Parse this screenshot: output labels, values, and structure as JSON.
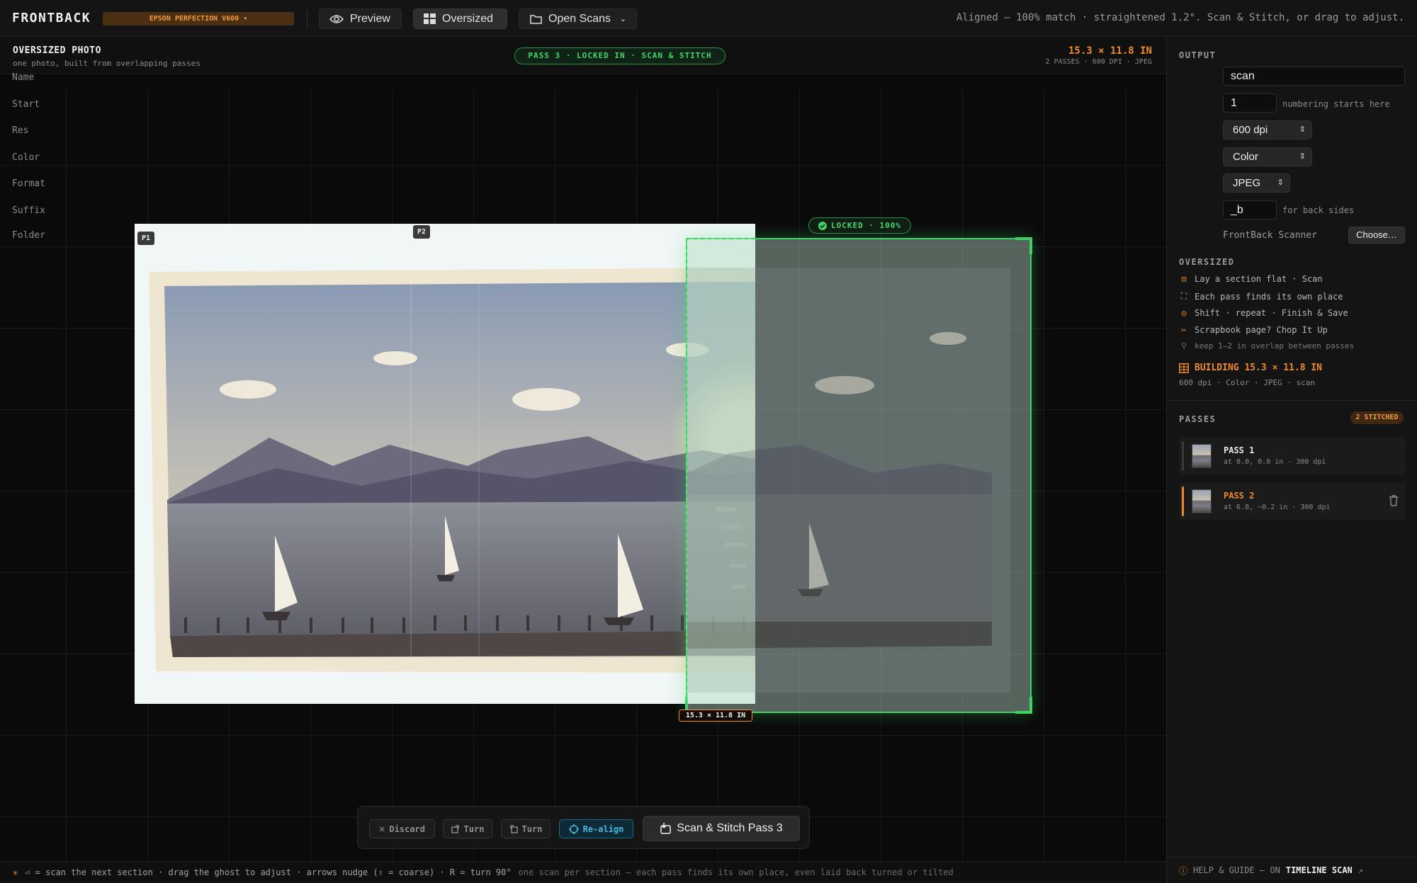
{
  "app": {
    "name": "FRONTBACK"
  },
  "topbar": {
    "device": "EPSON PERFECTION V600",
    "tabs": [
      {
        "label": "Preview",
        "icon": "eye-icon"
      },
      {
        "label": "Oversized",
        "icon": "grid-icon",
        "active": true
      },
      {
        "label": "Open Scans",
        "icon": "folder-icon"
      }
    ],
    "status": "Aligned — 100% match · straightened 1.2°. Scan & Stitch, or drag to adjust."
  },
  "subheader": {
    "title": "OVERSIZED PHOTO",
    "subtitle": "one photo, built from overlapping passes",
    "pass_pill": "PASS 3 · LOCKED IN · SCAN & STITCH",
    "dims": "15.3 × 11.8 IN",
    "dims_sub": "2 PASSES · 600 DPI · JPEG"
  },
  "canvas": {
    "pass_tags": [
      "P1",
      "P2"
    ],
    "locked": "LOCKED · 100%",
    "size_tag": "15.3 × 11.8 IN"
  },
  "toolbar": {
    "discard": "Discard",
    "turn_right": "Turn",
    "turn_left": "Turn",
    "realign": "Re-align",
    "primary": "Scan & Stitch Pass 3"
  },
  "footer": {
    "hint": "⏎ = scan the next section · drag the ghost to adjust · arrows nudge (⇧ = coarse) · R = turn 90°",
    "hint2": "one scan per section — each pass finds its own place, even laid back turned or tilted"
  },
  "sidebar": {
    "output_label": "OUTPUT",
    "fields": {
      "name": {
        "label": "Name",
        "value": "scan"
      },
      "start": {
        "label": "Start",
        "value": "1",
        "hint": "numbering starts here"
      },
      "res": {
        "label": "Res",
        "value": "600 dpi"
      },
      "color": {
        "label": "Color",
        "value": "Color"
      },
      "format": {
        "label": "Format",
        "value": "JPEG"
      },
      "suffix": {
        "label": "Suffix",
        "value": "_b",
        "hint": "for back sides"
      },
      "folder": {
        "label": "Folder",
        "value": "FrontBack Scanner",
        "button": "Choose…"
      }
    },
    "oversized_label": "OVERSIZED",
    "guide": [
      "Lay a section flat · Scan",
      "Each pass finds its own place",
      "Shift · repeat · Finish & Save",
      "Scrapbook page? Chop It Up"
    ],
    "guide_note": "keep 1–2 in overlap between passes",
    "building": "BUILDING 15.3 × 11.8 IN",
    "building_sub": "600 dpi · Color · JPEG · scan",
    "passes_label": "PASSES",
    "stitched_badge": "2 STITCHED",
    "passes": [
      {
        "name": "PASS 1",
        "detail": "at 0.0, 0.0 in · 300 dpi"
      },
      {
        "name": "PASS 2",
        "detail": "at 6.8, −0.2 in · 300 dpi"
      }
    ],
    "help_prefix": "HELP & GUIDE — ON",
    "help_strong": "TIMELINE SCAN",
    "help_arrow": "↗"
  },
  "colors": {
    "accent": "#f08a2c",
    "success": "#3cd364",
    "info": "#49b7e4",
    "bg": "#0b0b0c"
  }
}
